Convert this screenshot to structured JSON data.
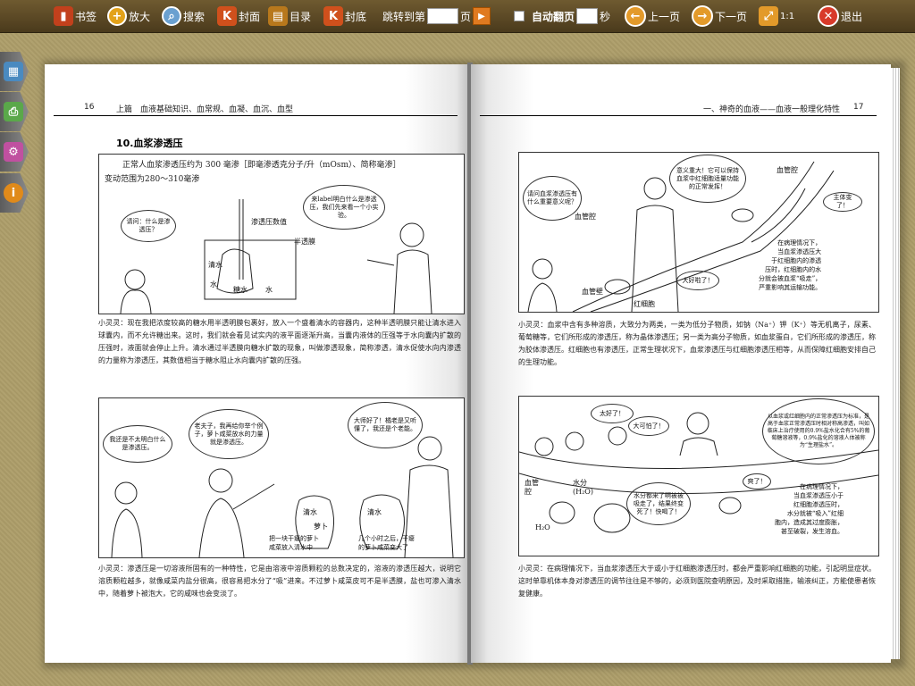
{
  "toolbar": {
    "bookmark": "书签",
    "zoom_in": "放大",
    "search": "搜索",
    "cover": "封面",
    "toc": "目录",
    "back_cover": "封底",
    "jump_prefix": "跳转到第",
    "jump_suffix": "页",
    "auto_flip": "自动翻页",
    "seconds": "秒",
    "prev": "上一页",
    "next": "下一页",
    "ratio": "1:1",
    "exit": "退出",
    "icons": {
      "bookmark": "bookmark-icon",
      "zoom": "magnifier-plus-icon",
      "search": "magnifier-icon",
      "cover": "k-cover-icon",
      "toc": "book-icon",
      "back_cover": "k-back-icon",
      "go": "play-icon",
      "prev": "arrow-left-icon",
      "next": "arrow-right-icon",
      "ratio": "fit-arrows-icon",
      "exit": "close-icon"
    },
    "colors": {
      "bar": "#4a3a1c",
      "accent": "#e07a20",
      "exit": "#d83a2a"
    }
  },
  "side_tabs": [
    "image-icon",
    "printer-icon",
    "gear-icon",
    "info-icon"
  ],
  "left_page": {
    "page_number": "16",
    "header": "上篇　血液基础知识、血常规、血凝、血沉、血型",
    "section": "10.血浆渗透压",
    "intro": [
      "正常人血浆渗透压约为 300 毫渗［即毫渗透克分子/升（mOsm）、简称毫渗］",
      "变动范围为280～310毫渗"
    ],
    "panel1": {
      "bubble_left": "请问：什么是渗透压？",
      "bubble_right": "来label明白什么是渗透压，我们先来看一个小实验。",
      "labels": [
        "渗透压数值",
        "半透膜",
        "清水",
        "糖水",
        "水",
        "水"
      ]
    },
    "para1": "小灵灵：现在我把浓度较高的糖水用半透明膜包裹好，放入一个盛着清水的容器内，这种半透明膜只能让清水进入球囊内，而不允许糖出来。这时，我们就会看见试实内的液平面逐渐升高，当囊内液体的压强等于水向囊内扩散的压强时，液面就会停止上升。清水通过半透膜向糖水扩散的现象，叫做渗透现象，简称渗透，清水促使水向内渗透的力量称为渗透压，其数值相当于糖水阻止水向囊内扩散的压强。",
    "panel2": {
      "bubble1": "我还是不太明白什么是渗透压。",
      "bubble2": "老夫子，我再给你举个例子，萝卜咸菜放水的力量就是渗透压。",
      "bubble3": "大师好了！橘老是又听懂了，我还是个老能。",
      "labels": [
        "清水",
        "萝卜",
        "清水"
      ],
      "caption_left": "把一块干瘪的萝卜\n咸菜放入清水中",
      "caption_right": "几个小时之后，干瘪\n的萝卜咸菜变大了"
    },
    "para2": "小灵灵：渗透压是一切溶液所固有的一种特性，它是由溶液中溶质颗粒的总数决定的，溶液的渗透压越大，说明它溶质颗粒越多，就像咸菜内盐分很高，很容易把水分了“吸”进来。不过萝卜咸菜皮可不是半透膜，盐也可渗入清水中，随着萝卜被泡大，它的咸味也会变淡了。"
  },
  "right_page": {
    "page_number": "17",
    "header": "一、神奇的血液——血液一般理化特性",
    "panel1": {
      "bubble1": "请问血浆渗透压有什么重要意义呢？",
      "bubble2": "意义重大！它可以保持血浆中红细胞适量功能的正常发挥！",
      "bubble3": "血管腔",
      "bubble4": "主体变了！",
      "bubble5": "大好啦了！",
      "labels": [
        "血管腔",
        "血管壁",
        "红细胞"
      ],
      "caption": "在病理情况下，\n当血浆渗透压大\n于红细胞内的渗透\n压时，红细胞内的水\n分就会被血浆“吸走”，\n严重影响其运输功能。"
    },
    "para1": "小灵灵：血浆中含有多种溶质，大致分为两类，一类为低分子物质，如钠（Na⁺）钾（K⁺）等无机离子，尿素、葡萄糖等，它们所形成的渗透压，称为晶体渗透压；另一类为高分子物质，如血浆蛋白，它们所形成的渗透压，称为胶体渗透压。红细胞也有渗透压，正常生理状况下，血浆渗透压与红细胞渗透压相等，从而保障红细胞安排自己的生理功能。",
    "panel2": {
      "bubble1": "太好了！",
      "bubble2": "大可怕了！",
      "bubble3": "以血浆或红细胞内的正常渗透压为标准，是高于血浆正常渗透压时相对称高渗透，叫如临床上治疗使用的0.9%盐水化合有5%的葡萄糖溶液等，0.9%盐化的溶液人体被称为“生理盐水”。",
      "bubble4": "水分都来了啊被被吸走了，结果终变死了！快喝了！",
      "bubble5": "爽了！",
      "labels": [
        "血管腔",
        "水分(H₂O)",
        "H₂O"
      ],
      "caption": "在病理情况下，\n当血浆渗透压小于\n红细胞渗透压时，\n水分就被“吸入”红细\n胞内，造成其过度膨胀，\n甚至破裂，发生溶血。"
    },
    "para2": "小灵灵：在病理情况下，当血浆渗透压大于或小于红细胞渗透压时，都会严重影响红细胞的功能，引起明显症状。这时单靠机体本身对渗透压的调节往往是不够的，必须到医院查明原因，及时采取措施，输液纠正，方能使患者恢复健康。"
  }
}
